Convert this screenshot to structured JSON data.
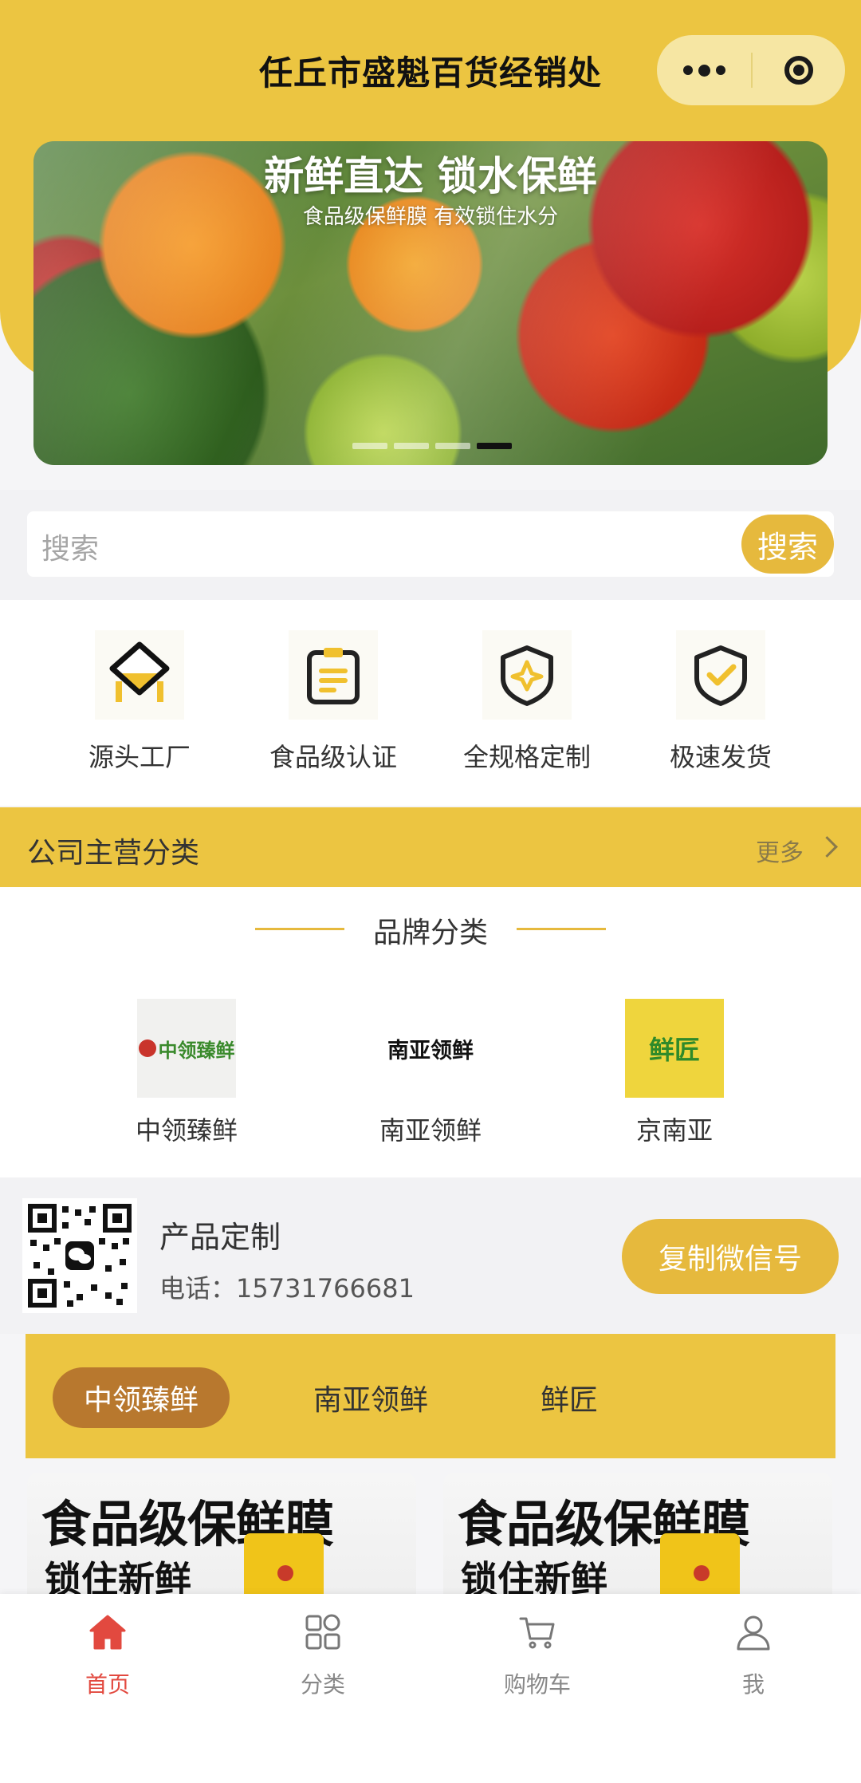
{
  "header": {
    "title": "任丘市盛魁百货经销处"
  },
  "banner": {
    "headline": "新鲜直达 锁水保鲜",
    "subline": "食品级保鲜膜 有效锁住水分",
    "slide_count": 4,
    "active_slide": 4
  },
  "search": {
    "placeholder": "搜索",
    "button_label": "搜索"
  },
  "features": [
    {
      "label": "源头工厂",
      "icon": "factory-icon"
    },
    {
      "label": "食品级认证",
      "icon": "clipboard-icon"
    },
    {
      "label": "全规格定制",
      "icon": "shield-star-icon"
    },
    {
      "label": "极速发货",
      "icon": "shield-check-icon"
    }
  ],
  "section": {
    "title": "公司主营分类",
    "more_label": "更多"
  },
  "brands": {
    "heading": "品牌分类",
    "items": [
      {
        "name": "中领臻鲜",
        "logo_text": "中领臻鲜"
      },
      {
        "name": "南亚领鲜",
        "logo_text": "南亚领鲜"
      },
      {
        "name": "京南亚",
        "logo_text": "鲜匠"
      }
    ]
  },
  "contact": {
    "title": "产品定制",
    "phone": "电话：15731766681",
    "copy_button": "复制微信号"
  },
  "tabs": [
    {
      "label": "中领臻鲜",
      "active": true
    },
    {
      "label": "南亚领鲜",
      "active": false
    },
    {
      "label": "鲜匠",
      "active": false
    }
  ],
  "products": [
    {
      "headline": "食品级保鲜膜",
      "subline": "锁住新鲜"
    },
    {
      "headline": "食品级保鲜膜",
      "subline": "锁住新鲜"
    }
  ],
  "nav": [
    {
      "label": "首页",
      "icon": "home-icon",
      "active": true
    },
    {
      "label": "分类",
      "icon": "category-icon",
      "active": false
    },
    {
      "label": "购物车",
      "icon": "cart-icon",
      "active": false
    },
    {
      "label": "我",
      "icon": "user-icon",
      "active": false
    }
  ],
  "colors": {
    "brand_yellow": "#ecc541",
    "button_gold": "#e6b93d",
    "tab_active": "#b8782e",
    "nav_active": "#e2493f"
  }
}
